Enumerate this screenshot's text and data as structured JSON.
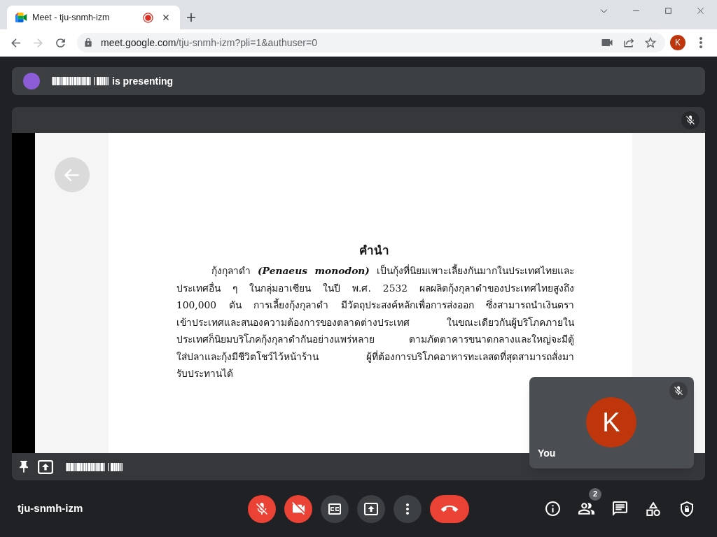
{
  "browser": {
    "tab": {
      "title": "Meet - tju-snmh-izm",
      "media_active": true
    },
    "nav": [
      {
        "kind": "back",
        "disabled": false
      },
      {
        "kind": "forward",
        "disabled": true
      },
      {
        "kind": "reload",
        "disabled": false
      }
    ],
    "url": {
      "host": "meet.google.com",
      "path": "/tju-snmh-izm?pli=1&authuser=0"
    },
    "profile_initial": "K"
  },
  "presenting_bar": {
    "text": "is presenting"
  },
  "presentation": {
    "muted": true,
    "document": {
      "heading": "คำนำ",
      "paragraph_lines": [
        "กุ้งกุลาดำ *(Penaeus monodon)* เป็นกุ้งที่นิยมเพาะเลี้ยงกันมากในประเทศไทยและ",
        "ประเทศอื่น ๆ ในกลุ่มอาเซียน ในปี พ.ศ. 2532 ผลผลิตกุ้งกุลาดำของประเทศไทยสูงถึง",
        "100,000 ตัน การเลี้ยงกุ้งกุลาดำ มีวัตถุประสงค์หลักเพื่อการส่งออก ซึ่งสามารถนำเงินตรา",
        "เข้าประเทศและสนองความต้องการของตลาดต่างประเทศ ในขณะเดียวกันผู้บริโภคภายใน",
        "ประเทศก็นิยมบริโภคกุ้งกุลาดำกันอย่างแพร่หลาย ตามภัตตาคารขนาดกลางและใหญ่จะมีตู้",
        "ใส่ปลาและกุ้งมีชีวิตโชว์ไว้หน้าร้าน ผู้ที่ต้องการบริโภคอาหารทะเลสดที่สุดสามารถสั่งมา",
        "รับประทานได้"
      ]
    }
  },
  "self_view": {
    "initial": "K",
    "label": "You",
    "muted": true
  },
  "bottom_bar": {
    "meeting_code": "tju-snmh-izm",
    "controls": [
      {
        "kind": "mic",
        "on": false
      },
      {
        "kind": "camera",
        "on": false
      },
      {
        "kind": "captions",
        "on": false
      },
      {
        "kind": "present",
        "on": false
      },
      {
        "kind": "more"
      },
      {
        "kind": "leave"
      }
    ],
    "side_buttons": [
      {
        "kind": "info"
      },
      {
        "kind": "people",
        "badge": "2"
      },
      {
        "kind": "chat"
      },
      {
        "kind": "activities"
      },
      {
        "kind": "host_controls"
      }
    ]
  }
}
